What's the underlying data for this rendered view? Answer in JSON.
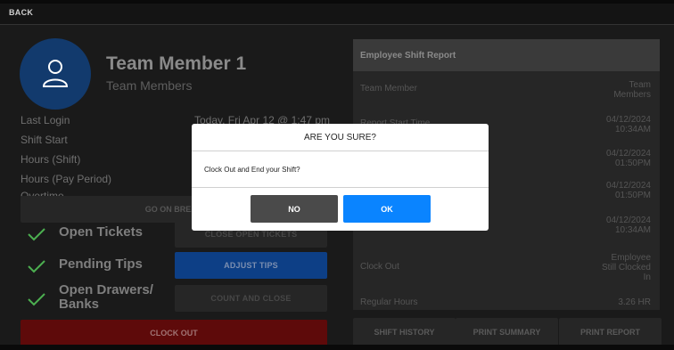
{
  "topbar": {
    "back_label": "BACK"
  },
  "member": {
    "name": "Team Member 1",
    "role": "Team Members"
  },
  "info": [
    {
      "label": "Last Login",
      "value": "Today, Fri Apr 12 @ 1:47 pm"
    },
    {
      "label": "Shift Start",
      "value": ""
    },
    {
      "label": "Hours (Shift)",
      "value": ""
    },
    {
      "label": "Hours (Pay Period)",
      "value": ""
    },
    {
      "label": "Overtime",
      "value": ""
    }
  ],
  "break_button": "GO ON BREAK",
  "tasks": [
    {
      "label": "Open Tickets",
      "button": "CLOSE OPEN TICKETS",
      "status": "done"
    },
    {
      "label": "Pending Tips",
      "button": "ADJUST TIPS",
      "status": "done"
    },
    {
      "label": "Open Drawers/\nBanks",
      "button": "COUNT AND CLOSE",
      "status": "done"
    }
  ],
  "clockout_button": "CLOCK OUT",
  "report": {
    "title": "Employee Shift Report",
    "rows": [
      {
        "label": "Team Member",
        "value": "Team\nMembers"
      },
      {
        "label": "Report Start Time",
        "value": "04/12/2024\n10:34AM"
      },
      {
        "label": "",
        "value": "04/12/2024\n01:50PM"
      },
      {
        "label": "",
        "value": "04/12/2024\n01:50PM"
      },
      {
        "label": "",
        "value": "04/12/2024\n10:34AM"
      },
      {
        "label": "Clock Out",
        "value": "Employee\nStill Clocked\nIn"
      },
      {
        "label": "Regular Hours",
        "value": "3.26 HR"
      }
    ],
    "buttons": [
      "SHIFT HISTORY",
      "PRINT SUMMARY",
      "PRINT REPORT"
    ]
  },
  "dialog": {
    "title": "ARE YOU SURE?",
    "message": "Clock Out and End your Shift?",
    "no_label": "NO",
    "ok_label": "OK"
  },
  "colors": {
    "accent_blue": "#0a84ff",
    "avatar_blue": "#123a6d",
    "clockout_red": "#5e0a0a",
    "check_green": "#4caf50"
  }
}
